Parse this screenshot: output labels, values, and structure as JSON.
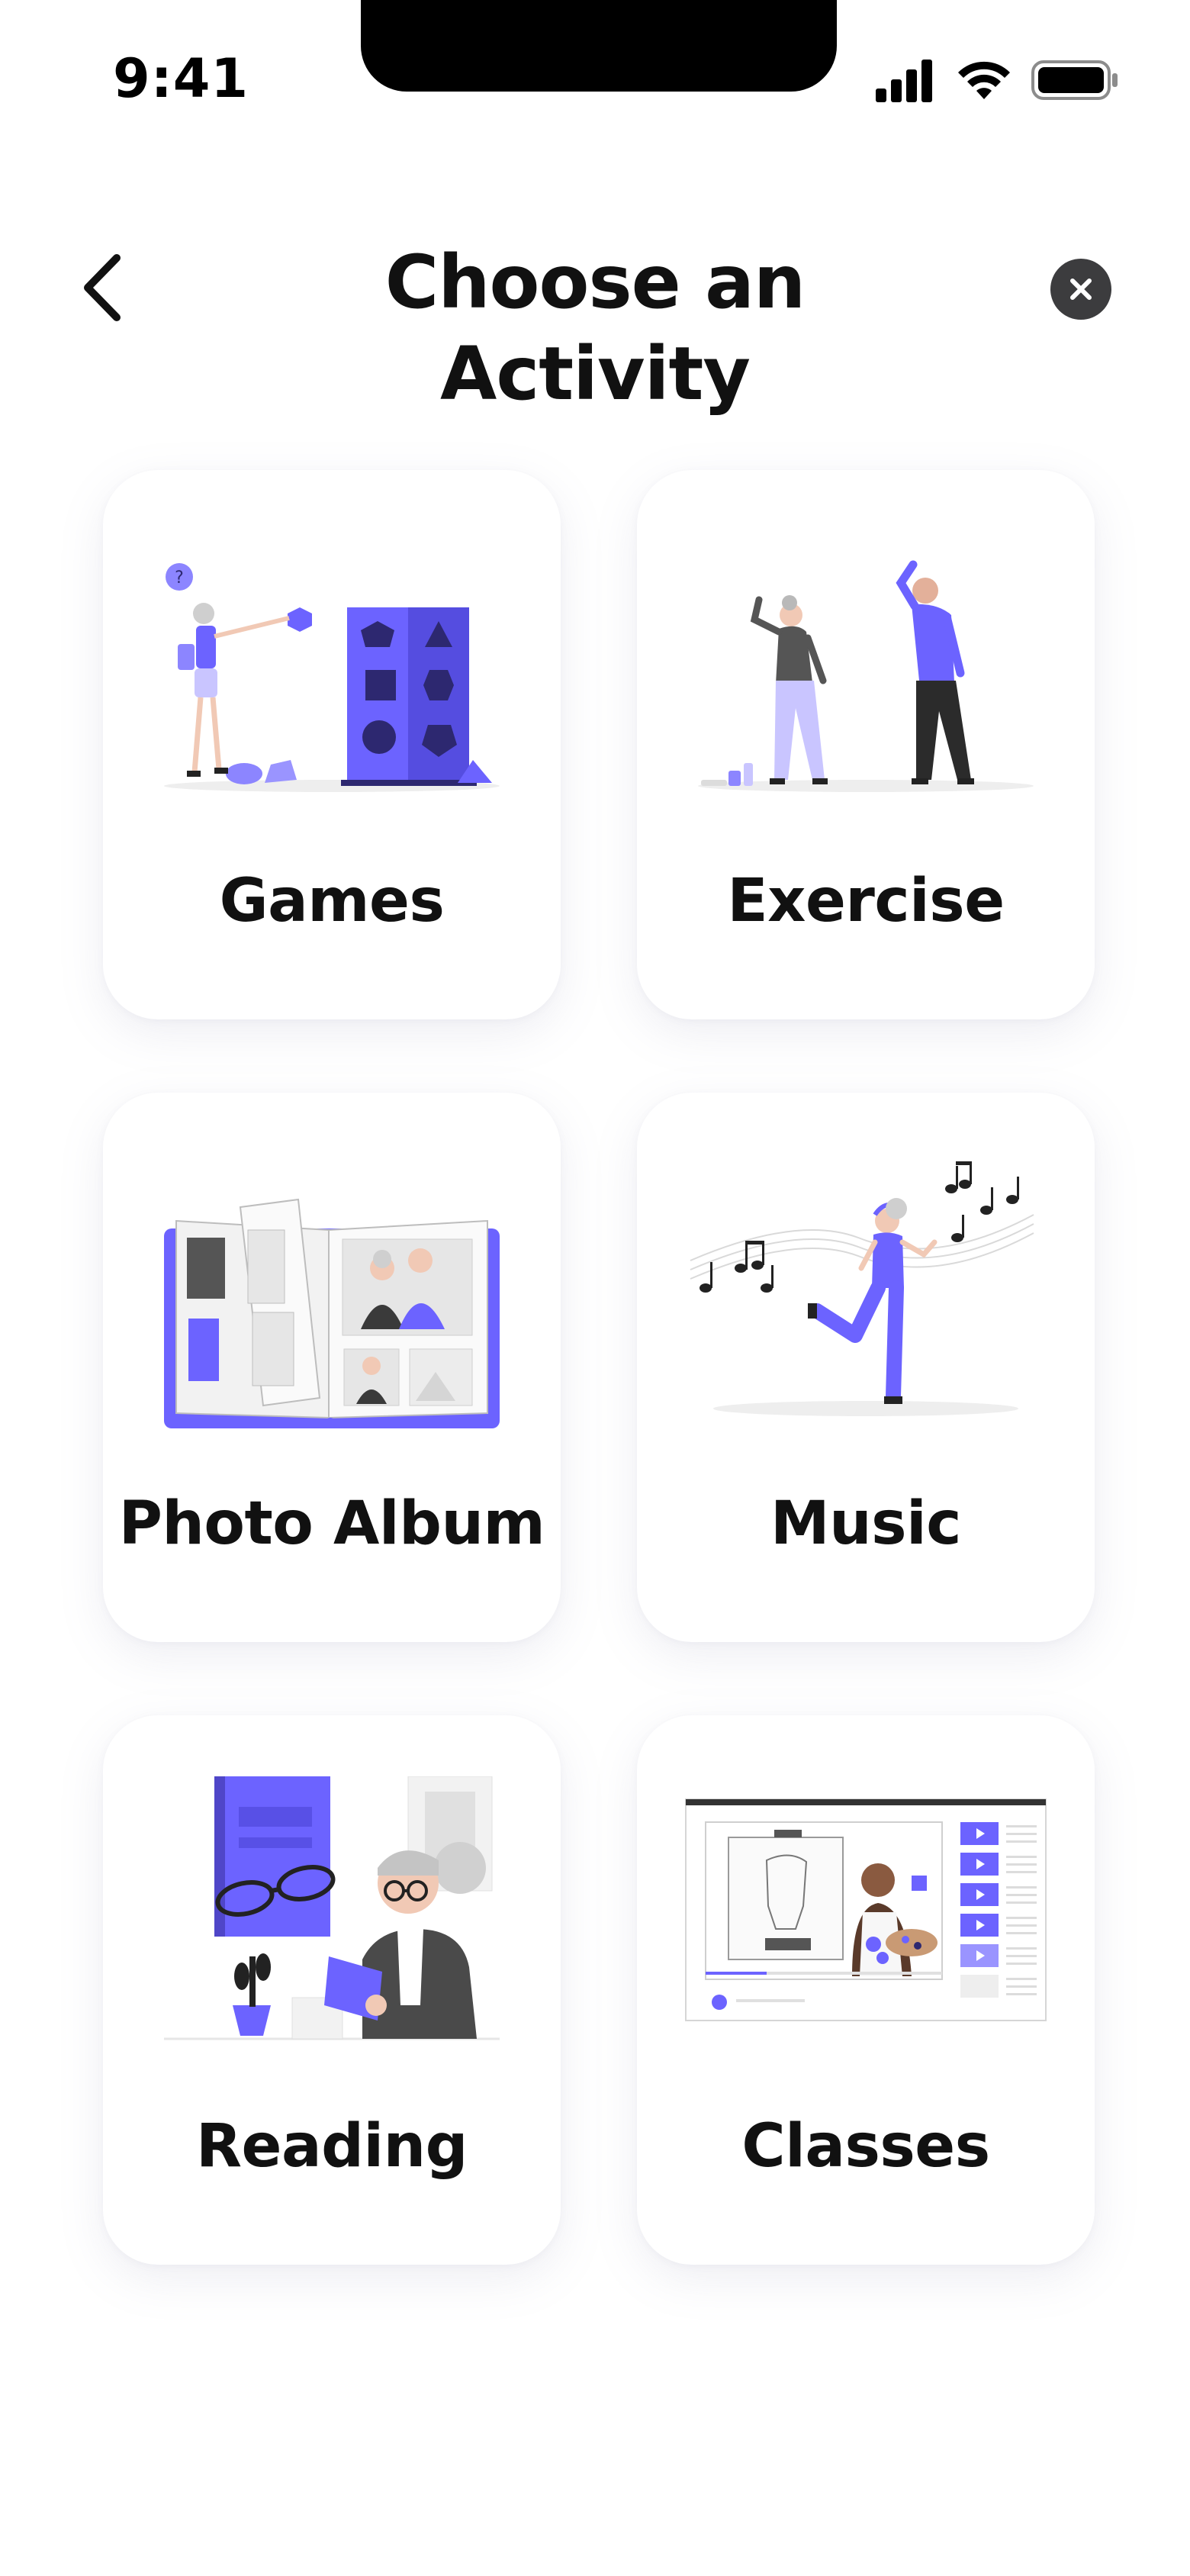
{
  "status_bar": {
    "time": "9:41",
    "icons": [
      "cellular-signal-icon",
      "wifi-icon",
      "battery-icon"
    ]
  },
  "header": {
    "title": "Choose an Activity",
    "back_icon": "chevron-left-icon",
    "close_icon": "close-icon"
  },
  "colors": {
    "accent": "#6c63ff",
    "accent_dark": "#4f46c8",
    "text": "#111111",
    "close_bg": "#3c3c3e",
    "card_bg": "#ffffff"
  },
  "activities": [
    {
      "label": "Games",
      "illustration": "shape-sorter-illustration"
    },
    {
      "label": "Exercise",
      "illustration": "stretching-couple-illustration"
    },
    {
      "label": "Photo Album",
      "illustration": "photo-album-illustration"
    },
    {
      "label": "Music",
      "illustration": "dancing-music-illustration"
    },
    {
      "label": "Reading",
      "illustration": "reading-woman-illustration"
    },
    {
      "label": "Classes",
      "illustration": "online-class-illustration"
    }
  ]
}
